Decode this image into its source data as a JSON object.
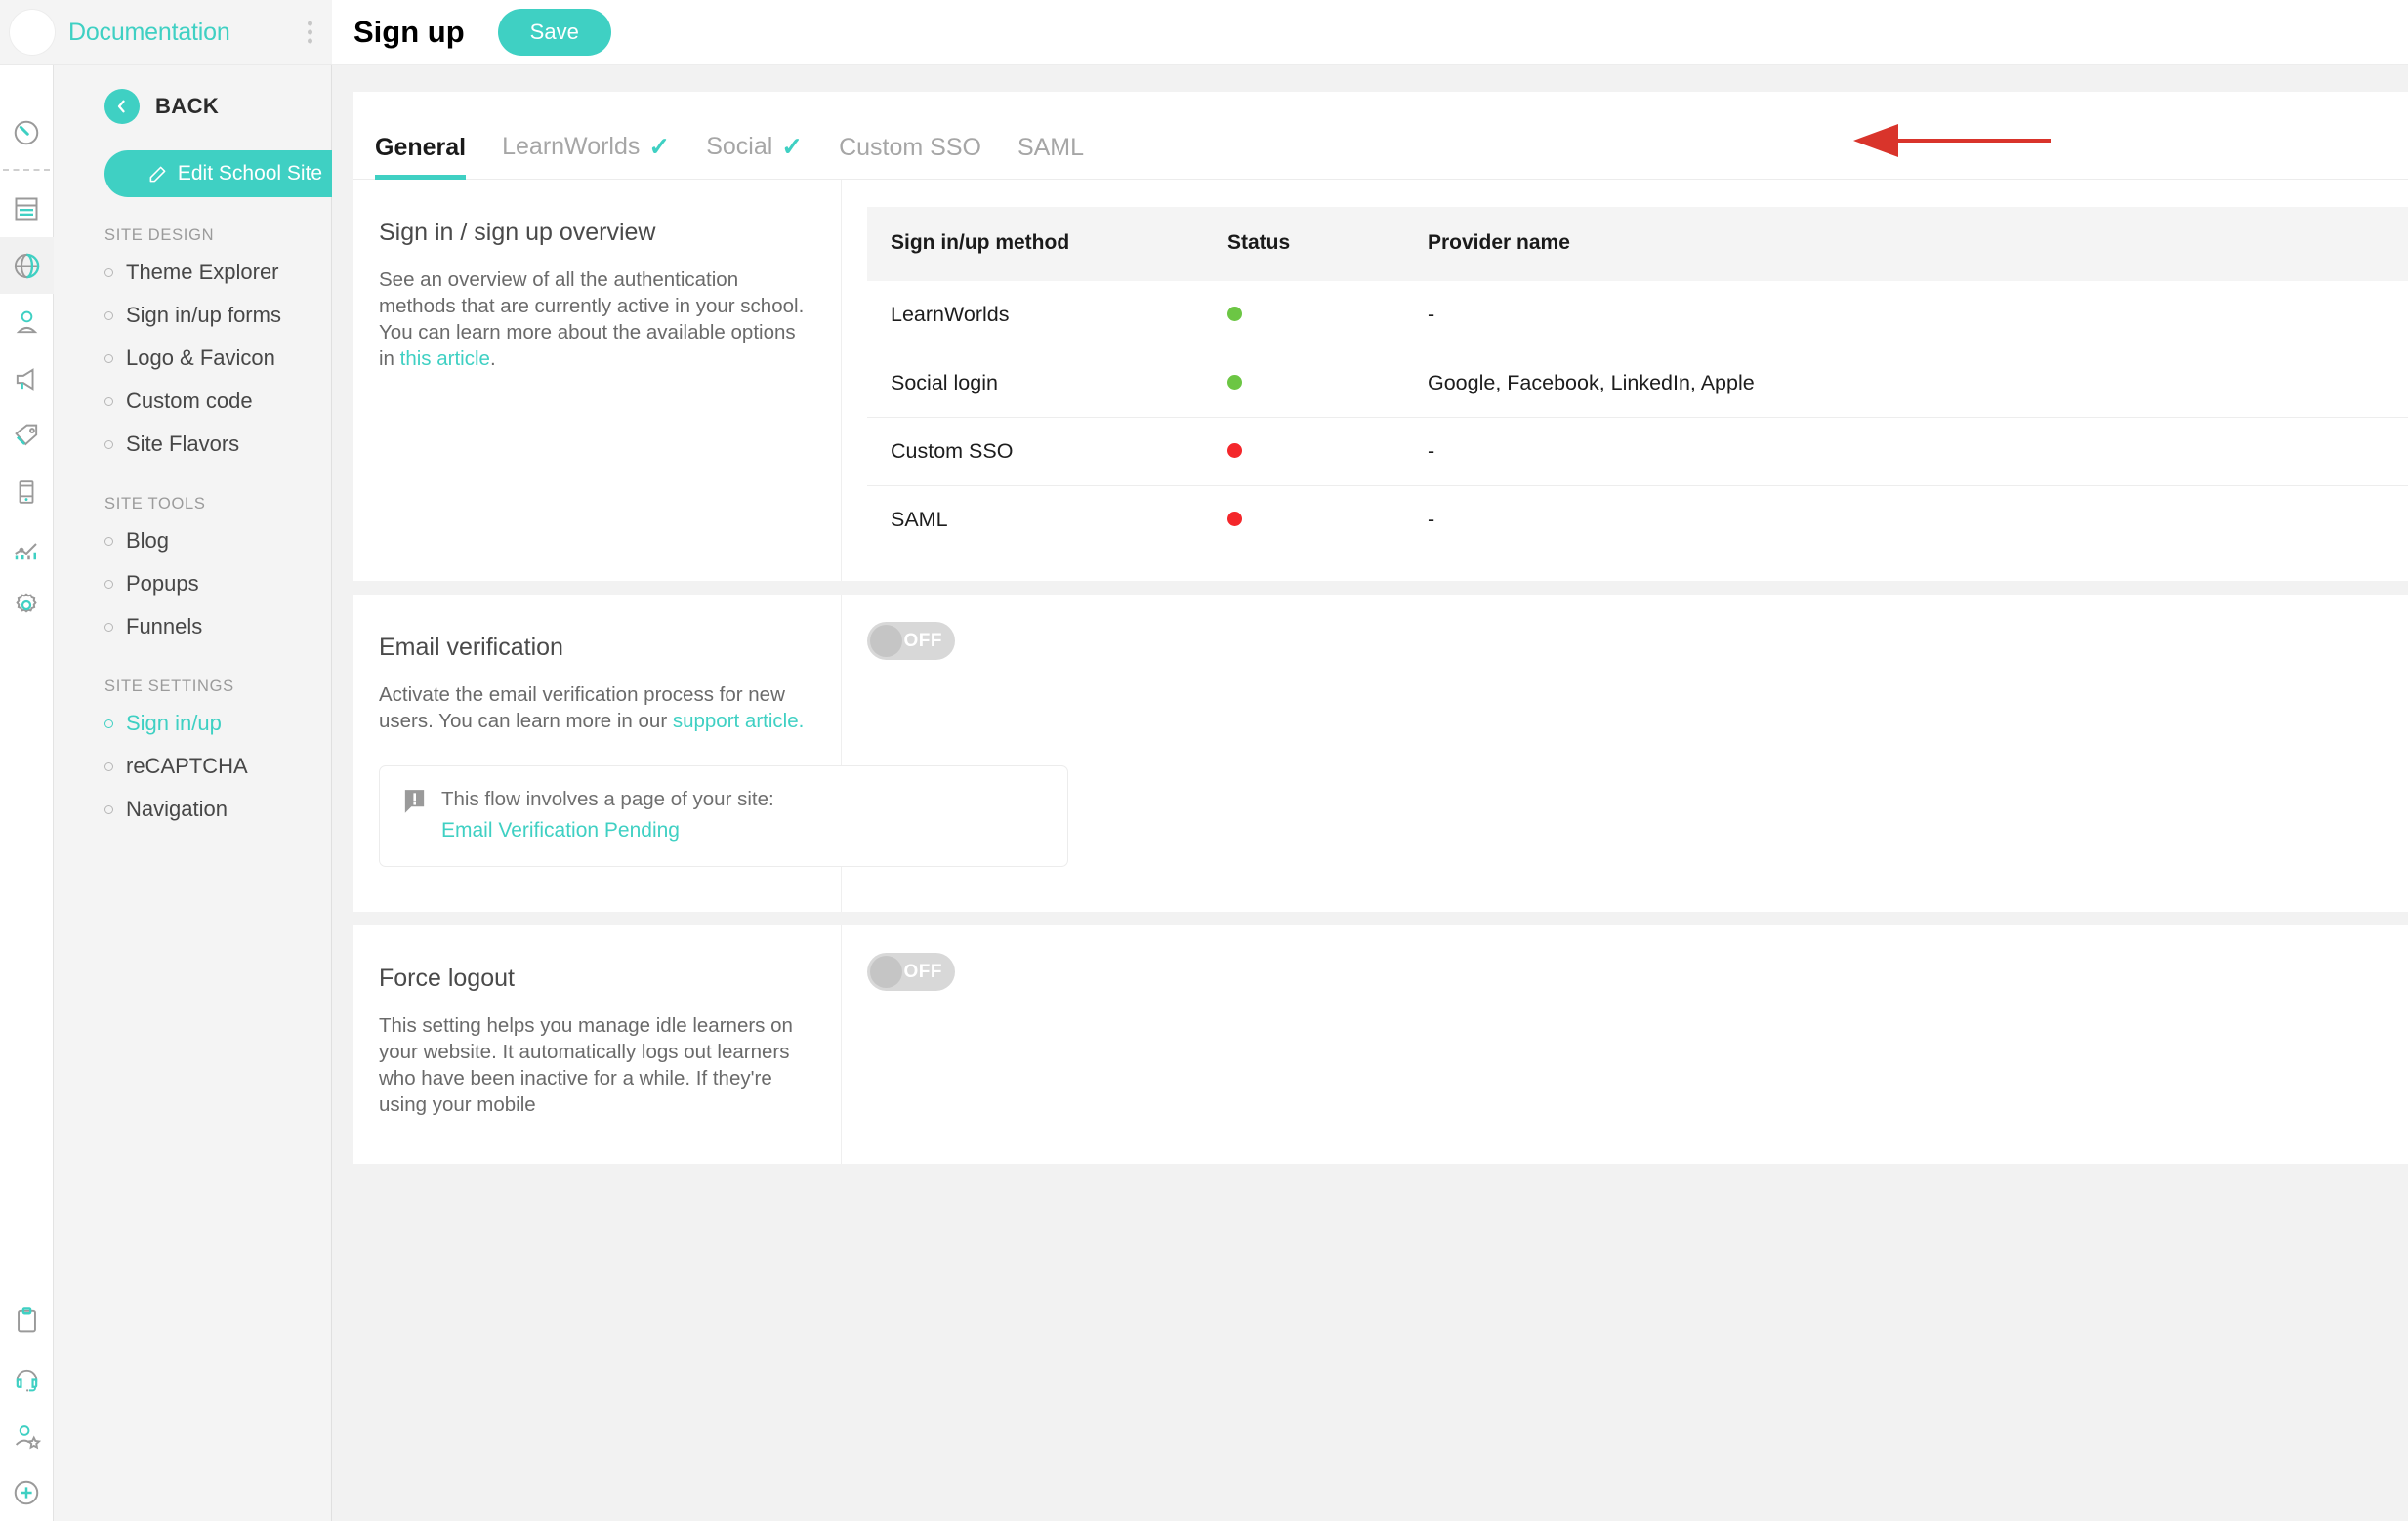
{
  "brand": {
    "name": "Documentation",
    "logo_colors": [
      "#cc3333",
      "#e8c233",
      "#12b6ef",
      "#1f9191",
      "#7cb83c",
      "#3fc9bd",
      "#f59b0b",
      "#ab8ee0",
      "#3b7ea8"
    ],
    "menu_icon": "kebab-menu-icon"
  },
  "rail": {
    "icons": [
      {
        "name": "dashboard-gauge-icon",
        "active": false
      },
      {
        "name": "site-pages-icon",
        "active": false
      },
      {
        "name": "website-globe-icon",
        "active": true
      },
      {
        "name": "users-icon",
        "active": false
      },
      {
        "name": "marketing-megaphone-icon",
        "active": false
      },
      {
        "name": "sales-tag-icon",
        "active": false
      },
      {
        "name": "mobile-app-icon",
        "active": false
      },
      {
        "name": "reports-chart-icon",
        "active": false
      },
      {
        "name": "settings-gear-icon",
        "active": false
      }
    ],
    "bottom_icons": [
      {
        "name": "tasks-clipboard-icon"
      },
      {
        "name": "support-headset-icon"
      },
      {
        "name": "account-star-icon"
      },
      {
        "name": "add-plus-icon"
      }
    ]
  },
  "sidebar": {
    "back_label": "BACK",
    "back_icon": "chevron-left-icon",
    "edit_button": {
      "label": "Edit School Site",
      "icon": "pencil-icon"
    },
    "groups": [
      {
        "title": "SITE DESIGN",
        "items": [
          {
            "label": "Theme Explorer",
            "active": false
          },
          {
            "label": "Sign in/up forms",
            "active": false
          },
          {
            "label": "Logo & Favicon",
            "active": false
          },
          {
            "label": "Custom code",
            "active": false
          },
          {
            "label": "Site Flavors",
            "active": false
          }
        ]
      },
      {
        "title": "SITE TOOLS",
        "items": [
          {
            "label": "Blog",
            "active": false
          },
          {
            "label": "Popups",
            "active": false
          },
          {
            "label": "Funnels",
            "active": false
          }
        ]
      },
      {
        "title": "SITE SETTINGS",
        "items": [
          {
            "label": "Sign in/up",
            "active": true
          },
          {
            "label": "reCAPTCHA",
            "active": false
          },
          {
            "label": "Navigation",
            "active": false
          }
        ]
      }
    ]
  },
  "header": {
    "title": "Sign up",
    "save_label": "Save"
  },
  "tabs": [
    {
      "label": "General",
      "active": true,
      "check": false
    },
    {
      "label": "LearnWorlds",
      "active": false,
      "check": true
    },
    {
      "label": "Social",
      "active": false,
      "check": true
    },
    {
      "label": "Custom SSO",
      "active": false,
      "check": false
    },
    {
      "label": "SAML",
      "active": false,
      "check": false
    }
  ],
  "annotation": {
    "type": "arrow-left",
    "color": "#d9342b",
    "points_to": "SAML"
  },
  "overview": {
    "title": "Sign in / sign up overview",
    "text_before_link": "See an overview of all the authentication methods that are currently active in your school. You can learn more about the available options in ",
    "link_text": "this article",
    "text_after_link": ".",
    "table": {
      "columns": [
        "Sign in/up method",
        "Status",
        "Provider name"
      ],
      "rows": [
        {
          "method": "LearnWorlds",
          "status": "on",
          "status_color": "#6cc644",
          "provider": "-"
        },
        {
          "method": "Social login",
          "status": "on",
          "status_color": "#6cc644",
          "provider": "Google, Facebook, LinkedIn, Apple"
        },
        {
          "method": "Custom SSO",
          "status": "off",
          "status_color": "#f4272b",
          "provider": "-"
        },
        {
          "method": "SAML",
          "status": "off",
          "status_color": "#f4272b",
          "provider": "-"
        }
      ]
    }
  },
  "email_verification": {
    "title": "Email verification",
    "text_before_link": "Activate the email verification process for new users. You can learn more in our ",
    "link_text": "support article.",
    "toggle": {
      "state": "OFF",
      "on": false
    },
    "callout": {
      "icon": "info-exclamation-icon",
      "line1": "This flow involves a page of your site:",
      "line2": "Email Verification Pending"
    }
  },
  "force_logout": {
    "title": "Force logout",
    "text": "This setting helps you manage idle learners on your website. It automatically logs out learners who have been inactive for a while. If they're using your mobile",
    "toggle": {
      "state": "OFF",
      "on": false
    }
  },
  "theme": {
    "accent": "#3fd0c3",
    "text_dark": "#2b2b2b",
    "text_muted": "#6a6a6a",
    "panel_bg": "#ffffff",
    "page_bg": "#f2f2f2"
  }
}
